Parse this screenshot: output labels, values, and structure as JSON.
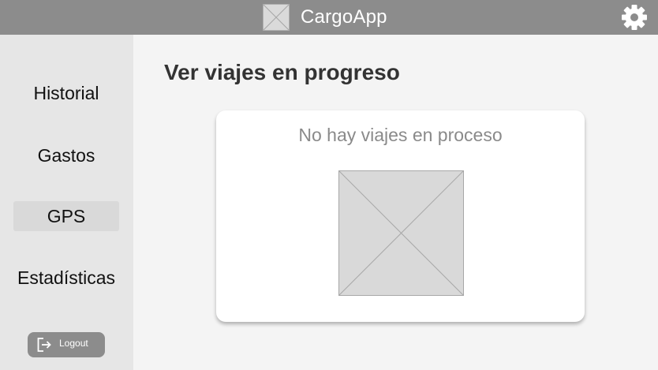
{
  "header": {
    "app_name": "CargoApp",
    "logo_icon": "image-placeholder-icon",
    "settings_icon": "gear-icon",
    "background_color": "#8c8c8c"
  },
  "sidebar": {
    "items": [
      {
        "label": "Historial",
        "active": false
      },
      {
        "label": "Gastos",
        "active": false
      },
      {
        "label": "GPS",
        "active": true
      },
      {
        "label": "Estadísticas",
        "active": false
      }
    ],
    "logout": {
      "label": "Logout",
      "icon": "logout-icon"
    }
  },
  "main": {
    "title": "Ver viajes en progreso",
    "card": {
      "empty_message": "No hay viajes en proceso",
      "image_icon": "image-placeholder-icon"
    }
  }
}
